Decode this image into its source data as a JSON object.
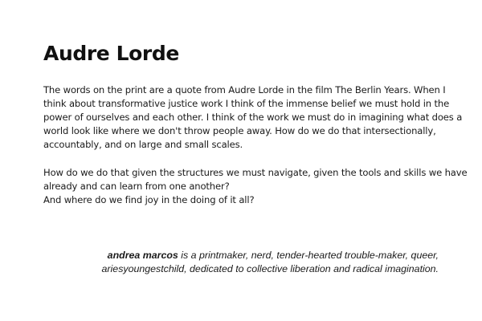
{
  "title": "Audre Lorde",
  "paragraph1": {
    "lines": [
      "The words on the print are a quote from Audre Lorde in the film The Berlin Years. When I",
      "think about transformative justice work I think of the immense belief we must hold in the",
      "power of ourselves and each other. I think of the work we must do in imagining what does a",
      "world look like where we don't throw people away. How do we do that intersectionally,",
      "accountably, and on large and small scales."
    ]
  },
  "paragraph2": {
    "lines": [
      "How do we do that given the structures we must navigate, given the tools and skills we have",
      "already and can learn from one another?",
      "And where do we find joy in the doing of it all?"
    ]
  },
  "bio": {
    "name": "andrea marcos",
    "line1_rest": " is a printmaker, nerd, tender-hearted trouble-maker, queer,",
    "line2": "ariesyoungestchild, dedicated to collective liberation and radical imagination."
  }
}
